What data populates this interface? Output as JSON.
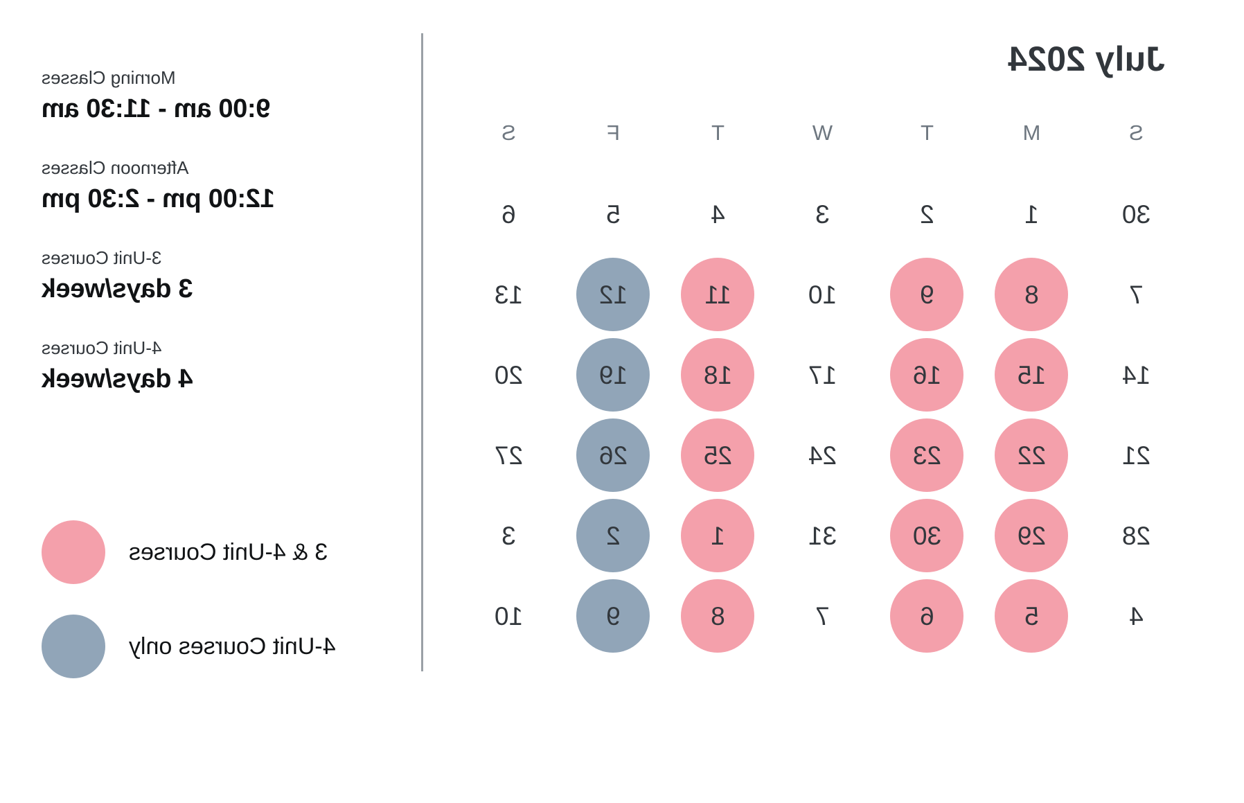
{
  "calendar": {
    "title": "July 2024",
    "weekdays": [
      "S",
      "M",
      "T",
      "W",
      "T",
      "F",
      "S"
    ],
    "weeks": [
      [
        {
          "day": "30",
          "state": "plain"
        },
        {
          "day": "1",
          "state": "plain"
        },
        {
          "day": "2",
          "state": "plain"
        },
        {
          "day": "3",
          "state": "plain"
        },
        {
          "day": "4",
          "state": "plain"
        },
        {
          "day": "5",
          "state": "plain"
        },
        {
          "day": "6",
          "state": "plain"
        }
      ],
      [
        {
          "day": "7",
          "state": "plain"
        },
        {
          "day": "8",
          "state": "pink"
        },
        {
          "day": "9",
          "state": "pink"
        },
        {
          "day": "10",
          "state": "plain"
        },
        {
          "day": "11",
          "state": "pink"
        },
        {
          "day": "12",
          "state": "blue"
        },
        {
          "day": "13",
          "state": "plain"
        }
      ],
      [
        {
          "day": "14",
          "state": "plain"
        },
        {
          "day": "15",
          "state": "pink"
        },
        {
          "day": "16",
          "state": "pink"
        },
        {
          "day": "17",
          "state": "plain"
        },
        {
          "day": "18",
          "state": "pink"
        },
        {
          "day": "19",
          "state": "blue"
        },
        {
          "day": "20",
          "state": "plain"
        }
      ],
      [
        {
          "day": "21",
          "state": "plain"
        },
        {
          "day": "22",
          "state": "pink"
        },
        {
          "day": "23",
          "state": "pink"
        },
        {
          "day": "24",
          "state": "plain"
        },
        {
          "day": "25",
          "state": "pink"
        },
        {
          "day": "26",
          "state": "blue"
        },
        {
          "day": "27",
          "state": "plain"
        }
      ],
      [
        {
          "day": "28",
          "state": "plain"
        },
        {
          "day": "29",
          "state": "pink"
        },
        {
          "day": "30",
          "state": "pink"
        },
        {
          "day": "31",
          "state": "plain"
        },
        {
          "day": "1",
          "state": "pink"
        },
        {
          "day": "2",
          "state": "blue"
        },
        {
          "day": "3",
          "state": "plain"
        }
      ],
      [
        {
          "day": "4",
          "state": "plain"
        },
        {
          "day": "5",
          "state": "pink"
        },
        {
          "day": "6",
          "state": "pink"
        },
        {
          "day": "7",
          "state": "plain"
        },
        {
          "day": "8",
          "state": "pink"
        },
        {
          "day": "9",
          "state": "blue"
        },
        {
          "day": "10",
          "state": "plain"
        }
      ]
    ]
  },
  "info": {
    "morning": {
      "caption": "Morning Classes",
      "value": "9:00 am - 11:30 am"
    },
    "afternoon": {
      "caption": "Afternoon Classes",
      "value": "12:00 pm - 2:30 pm"
    },
    "three_unit": {
      "caption": "3-Unit Courses",
      "value": "3 days/week"
    },
    "four_unit": {
      "caption": "4-Unit Courses",
      "value": "4 days/week"
    }
  },
  "legend": [
    {
      "swatch": "pink",
      "label": "3 & 4-Unit Courses"
    },
    {
      "swatch": "blue",
      "label": "4-Unit Courses only"
    }
  ],
  "colors": {
    "pink": "#F4A0AB",
    "blue": "#91A5B8",
    "text_dark": "#32373C",
    "text_muted": "#6E7780",
    "divider": "#9AA0A6",
    "background": "#FFFFFF"
  }
}
